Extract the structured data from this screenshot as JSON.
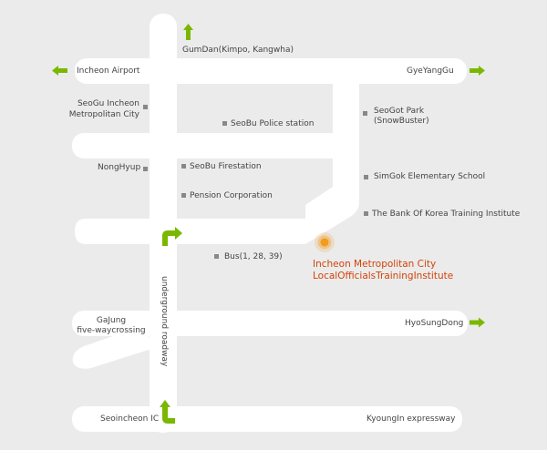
{
  "colors": {
    "background": "#ebebeb",
    "road": "#ffffff",
    "arrow": "#7ab800",
    "marker": "#888888",
    "destination": "#d2430a",
    "destination_dot": "#f29b1d"
  },
  "labels": {
    "gumdan": "GumDan(Kimpo, Kangwha)",
    "incheon_airport": "Incheon Airport",
    "gyeyanggu": "GyeYangGu",
    "seogu_office_line1": "SeoGu Incheon",
    "seogu_office_line2": "Metropolitan City",
    "seobu_police": "SeoBu Police station",
    "seogot_park_line1": "SeoGot Park",
    "seogot_park_line2": "(SnowBuster)",
    "nonghyup": "NongHyup",
    "seobu_fire": "SeoBu Firestation",
    "simgok_school": "SimGok Elementary School",
    "pension_corp": "Pension Corporation",
    "bank_of_korea": "The Bank Of Korea Training Institute",
    "bus": "Bus(1, 28, 39)",
    "destination_line1": "Incheon Metropolitan City",
    "destination_line2": "LocalOfficialsTrainingInstitute",
    "underground_roadway": "underground roadway",
    "gajung_line1": "GaJung",
    "gajung_line2": "five-waycrossing",
    "hyosungdong": "HyoSungDong",
    "seoincheon_ic": "Seoincheon IC",
    "kyoungin_expressway": "KyoungIn expressway"
  }
}
